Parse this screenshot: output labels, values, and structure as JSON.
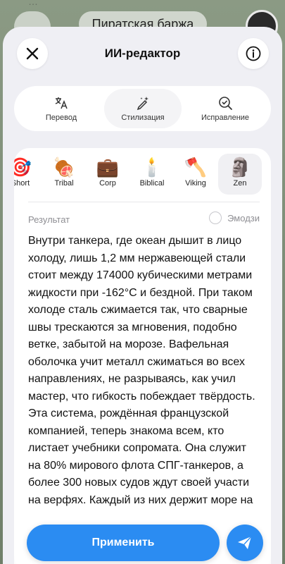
{
  "background": {
    "chat_title": "Пиратская баржа",
    "faded_text": "…"
  },
  "header": {
    "title": "ИИ-редактор",
    "close_icon": "close-icon",
    "info_icon": "info-icon"
  },
  "modes": [
    {
      "label": "Перевод",
      "icon": "translate-icon"
    },
    {
      "label": "Стилизация",
      "icon": "magic-pen-icon",
      "active": true
    },
    {
      "label": "Исправление",
      "icon": "check-search-icon"
    }
  ],
  "styles": [
    {
      "label": "Short",
      "emoji": "🎯"
    },
    {
      "label": "Tribal",
      "emoji": "🍖"
    },
    {
      "label": "Corp",
      "emoji": "💼"
    },
    {
      "label": "Biblical",
      "emoji": "🕯️"
    },
    {
      "label": "Viking",
      "emoji": "🪓"
    },
    {
      "label": "Zen",
      "emoji": "🗿",
      "active": true
    }
  ],
  "result": {
    "label": "Результат",
    "emoji_toggle": "Эмодзи",
    "text": "Внутри танкера, где океан дышит в лицо холоду, лишь 1,2 мм нержавеющей стали стоит между 174000 кубическими метрами жидкости при -162°C и бездной. При таком холоде сталь сжимается так, что сварные швы трескаются за мгновения, подобно ветке, забытой на морозе. Вафельная оболочка учит металл сжиматься во всех направлениях, не разрываясь, как учил мастер, что гибкость побеждает твёрдость. Эта система, рождённая французской компанией, теперь знакома всем, кто листает учебники сопромата. Она служит на 80% мирового флота СПГ-танкеров, а более 300 новых судов ждут своей участи на верфях. Каждый из них держит море на"
  },
  "actions": {
    "apply_label": "Применить",
    "send_icon": "send-icon"
  },
  "colors": {
    "accent": "#2b8cf2"
  }
}
